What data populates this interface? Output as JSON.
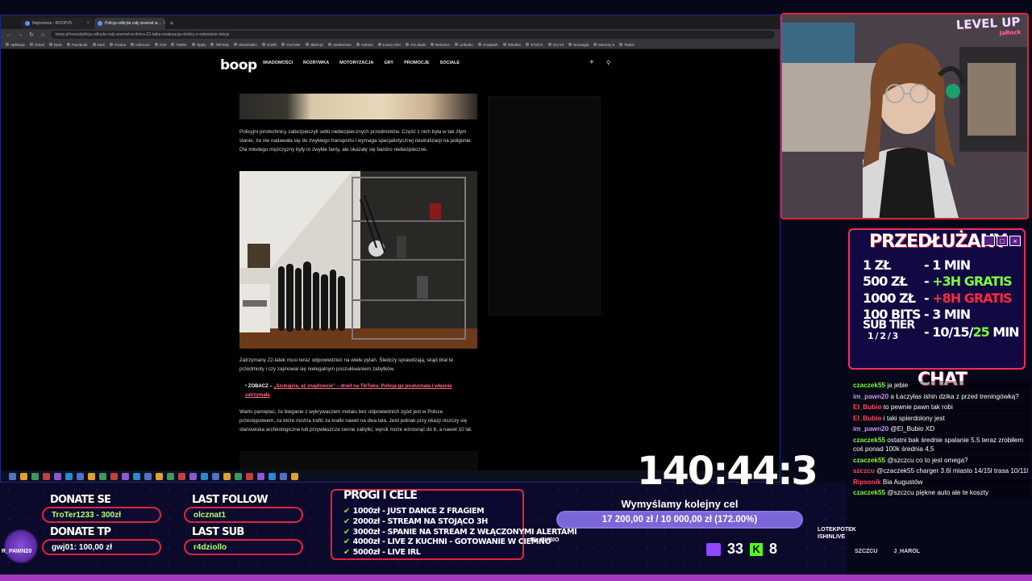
{
  "browser": {
    "tabs": [
      {
        "label": "Najnowsze - BOOP.PL",
        "active": false
      },
      {
        "label": "Policja odkryła cały arsenał w...",
        "active": true
      }
    ],
    "url": "boop.pl/news/policja-odkryla-caly-arsenal-w-domu-22-latka-ewakuacja-okolicy-z-odwolanie-lekcje",
    "bookmarks": [
      "Aplikacje",
      "Gmail",
      "Dysk",
      "Facebook",
      "work",
      "Oculus",
      "IshinLive",
      "Kick",
      "Twitter",
      "Tipply",
      "TikFinity",
      "Streamlabs",
      "Grafik",
      "YouTube",
      "JBZD.pl",
      "JoeMonster",
      "Games",
      "Łowcy Gier",
      "GG.deals",
      "Behance",
      "LinkedIn",
      "Unsplash",
      "Shinden",
      "STOCK",
      "Gry tnt",
      "Norwegia",
      "Memory 5",
      "Twitch"
    ]
  },
  "site": {
    "logo": "boop",
    "nav": [
      "WIADOMOŚCI",
      "ROZRYWKA",
      "MOTORYZACJA",
      "GRY",
      "PROMOCJE",
      "SOCIALE"
    ],
    "paragraph_1": "Policyjni pirotechnicy zabezpieczyli setki niebezpiecznych przedmiotów. Część z nich była w tak złym stanie, że nie nadawała się do zwykłego transportu i wymaga specjalistycznej neutralizacji na poligonie. Dla młodego mężczyzny były to zwykłe fanty, ale okazały się bardzo niebezpieczne.",
    "paragraph_2": "Zatrzymany 22-latek musi teraz odpowiedzieć na wiele pytań. Śledczy sprawdzają, skąd brał te przedmioty i czy zajmował się nielegalnym poszukiwaniem zabytków.",
    "bullet_prefix": "ZOBACZ –",
    "bullet_link": "„Szukajcie, aż znajdziecie” – drwił na TikToku. Policja go posłuchała i właśnie zatrzymała",
    "paragraph_3": "Warto pamiętać, że bieganie z wykrywaczem metalu bez odpowiednich zgód jest w Polsce przestępstwem, za które można trafić za kratki nawet na dwa lata. Jeśli jednak przy okazji niszczy się stanowiska archeologiczne lub przywłaszcza cenne zabytki, wyrok może wzrosnąć do 8, a nawet 10 lat."
  },
  "overlay": {
    "level_up": "LEVEL UP",
    "level_up_sub": "JaRock",
    "subathon_title": "PRZEDŁUŻANY",
    "subathon_rows": [
      {
        "k": "1 ZŁ",
        "v": "- 1 MIN",
        "extra": "",
        "extra_color": ""
      },
      {
        "k": "500 ZŁ",
        "v": "- ",
        "extra": "+3H GRATIS",
        "extra_color": "green"
      },
      {
        "k": "1000 ZŁ",
        "v": "- ",
        "extra": "+8H GRATIS",
        "extra_color": "red"
      },
      {
        "k": "100 BITS",
        "v": "- 3 MIN",
        "extra": "",
        "extra_color": ""
      }
    ],
    "sub_tier_label": "SUB TIER",
    "sub_tier_sub": "1 / 2 / 3",
    "sub_tier_value_1": "- 10/15/",
    "sub_tier_value_2": "25",
    "sub_tier_value_3": " MIN",
    "chat_title": "CHAT",
    "chat": [
      {
        "user": "czaczek55",
        "color": "#7dff3a",
        "text": "ja jebie"
      },
      {
        "user": "im_pawn20",
        "color": "#c896ff",
        "text": "a Łaczyłas ishin dzika z przed treningówką?"
      },
      {
        "user": "El_Bubio",
        "color": "#ff4a6a",
        "text": "to pewnie pawn tak robi"
      },
      {
        "user": "El_Bubio",
        "color": "#ff4a6a",
        "text": "i taki spierdolony jest"
      },
      {
        "user": "im_pawn20",
        "color": "#c896ff",
        "text": "@El_Bubio XD"
      },
      {
        "user": "czaczek55",
        "color": "#7dff3a",
        "text": "ostatni bak średnie spalanie 5.5 teraz zrobiłem coś ponad 100k średnia 4,5"
      },
      {
        "user": "czaczek55",
        "color": "#7dff3a",
        "text": "@szczcu co to jest omega?"
      },
      {
        "user": "szczcu",
        "color": "#ff4a6a",
        "text": "@czaczek55 charger 3.6l miasto 14/15l trasa 10/11l"
      },
      {
        "user": "Ripsonik",
        "color": "#ff4a6a",
        "text": "Bia Augustów"
      },
      {
        "user": "czaczek55",
        "color": "#7dff3a",
        "text": "@szczcu piękne auto ale te koszty"
      }
    ],
    "chat_footer_1": "SZCZCU",
    "chat_footer_2": "J_HAROL",
    "timer": "140:44:3",
    "donate_se_label": "DONATE SE",
    "donate_se_value": "TroTer1233 - 300zł",
    "donate_tp_label": "DONATE TP",
    "donate_tp_value": "gwj01: 100,00 zł",
    "last_follow_label": "LAST FOLLOW",
    "last_follow_value": "olcznat1",
    "last_sub_label": "LAST SUB",
    "last_sub_value": "r4dziollo",
    "progi_title": "PROGI I CELE",
    "progi": [
      "1000zł - JUST DANCE Z FRAGIEM",
      "2000zł - STREAM NA STOJĄCO 3H",
      "3000zł - SPANIE NA STREAM Z WŁĄCZONYMI ALERTAMI",
      "4000zł - LIVE Z KUCHNI - GOTOWANIE W CIEMNO",
      "5000zł - LIVE IRL"
    ],
    "goal_title": "Wymyślamy kolejny cel",
    "goal_progress": "17 200,00 zł / 10 000,00 zł (172.00%)",
    "goal_fraction": 1.0,
    "twitch_count": "33",
    "kick_count": "8",
    "el_bubio": "EL_BUBIO",
    "lootek_1": "LOTEKPOTEK",
    "lootek_2": "ISHINLIVE",
    "sprite_label": "R_PAWN20"
  }
}
